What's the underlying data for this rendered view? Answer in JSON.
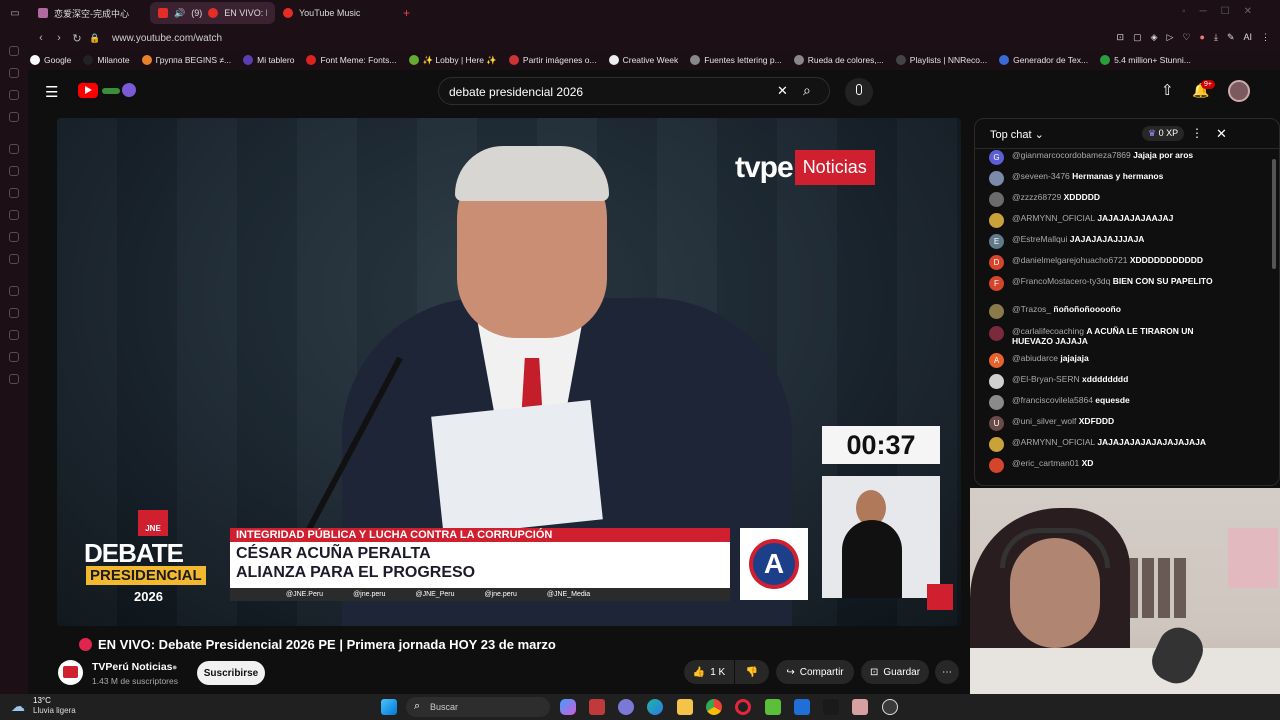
{
  "browser": {
    "tabs": [
      {
        "title": "恋爱深空-完成中心",
        "active": false
      },
      {
        "title": "(9)",
        "title2": "EN VIVO: Debat",
        "active": true
      },
      {
        "title": "YouTube Music",
        "active": false
      }
    ],
    "new_tab_glyph": "+",
    "url": "www.youtube.com/watch",
    "ai_label": "AI",
    "bookmarks": [
      {
        "label": "Google",
        "color": "#ffffff"
      },
      {
        "label": "Milanote",
        "color": "#222222"
      },
      {
        "label": "Группа BEGINS ≠...",
        "color": "#e8832b"
      },
      {
        "label": "Mi tablero",
        "color": "#5a3fb0"
      },
      {
        "label": "Font Meme: Fonts...",
        "color": "#d22"
      },
      {
        "label": "✨ Lobby | Here ✨",
        "color": "#6a3"
      },
      {
        "label": "Partir imágenes o...",
        "color": "#c33"
      },
      {
        "label": "Creative Week",
        "color": "#eee"
      },
      {
        "label": "Fuentes lettering p...",
        "color": "#888"
      },
      {
        "label": "Rueda de colores,...",
        "color": "#888"
      },
      {
        "label": "Playlists | NNReco...",
        "color": "#444"
      },
      {
        "label": "Generador de Tex...",
        "color": "#3b6ad6"
      },
      {
        "label": "5.4 million+ Stunni...",
        "color": "#2b9d3a"
      }
    ]
  },
  "youtube": {
    "search_query": "debate presidencial 2026",
    "notif_count": "9+",
    "video": {
      "channel_bug_tv": "tvpe",
      "channel_bug_noticias": "Noticias",
      "timer": "00:37",
      "lower_third_topic": "INTEGRIDAD PÚBLICA Y LUCHA CONTRA LA CORRUPCIÓN",
      "lower_third_name": "CÉSAR ACUÑA PERALTA",
      "lower_third_party": "ALIANZA PARA EL PROGRESO",
      "party_logo_letter": "A",
      "socials": [
        "@JNE.Peru",
        "@jne.peru",
        "@JNE_Peru",
        "@jne.peru",
        "@JNE_Media"
      ],
      "debate_logo_jne": "JNE",
      "debate_logo_title": "DEBATE",
      "debate_logo_sub": "PRESIDENCIAL",
      "debate_logo_year": "2026"
    },
    "title": "EN VIVO: Debate Presidencial 2026 PE | Primera jornada HOY 23 de marzo",
    "channel": {
      "name": "TVPerú Noticias",
      "subs": "1.43 M de suscriptores",
      "subscribe": "Suscribirse"
    },
    "actions": {
      "likes": "1 K",
      "share": "Compartir",
      "save": "Guardar"
    },
    "chat": {
      "header": "Top chat",
      "xp": "0 XP",
      "messages": [
        {
          "author": "@gianmarcocordobameza7869",
          "text": "Jajaja por aros",
          "avatar": "G",
          "color": "#5b5ed6"
        },
        {
          "author": "@seveen-3476",
          "text": "Hermanas y hermanos",
          "avatar": "",
          "color": "#7a8aa8"
        },
        {
          "author": "@zzzz68729",
          "text": "XDDDDD",
          "avatar": "",
          "color": "#6b6b6b"
        },
        {
          "author": "@ARMYNN_OFICIAL",
          "text": "JAJAJAJAJAAJAJ",
          "avatar": "",
          "color": "#c9a23a"
        },
        {
          "author": "@EstreMallqui",
          "text": "JAJAJAJAJJJAJA",
          "avatar": "E",
          "color": "#5f7a8a"
        },
        {
          "author": "@danielmelgarejohuacho6721",
          "text": "XDDDDDDDDDDD",
          "avatar": "D",
          "color": "#d4452b"
        },
        {
          "author": "@FrancoMostacero-ty3dq",
          "text": "BIEN CON SU PAPELITO",
          "avatar": "F",
          "color": "#d4452b"
        },
        {
          "author": "@Trazos_",
          "text": "ñoñoñoñooooño",
          "avatar": "",
          "color": "#8a7a4a"
        },
        {
          "author": "@carlalifecoaching",
          "text": "A ACUÑA LE TIRARON UN HUEVAZO JAJAJA",
          "avatar": "",
          "color": "#7a2a3a"
        },
        {
          "author": "@abiudarce",
          "text": "jajajaja",
          "avatar": "A",
          "color": "#e8632b"
        },
        {
          "author": "@El-Bryan-SERN",
          "text": "xdddddddd",
          "avatar": "",
          "color": "#cfcfcf"
        },
        {
          "author": "@franciscovilela5864",
          "text": "equesde",
          "avatar": "",
          "color": "#8a8a8a"
        },
        {
          "author": "@uni_silver_wolf",
          "text": "XDFDDD",
          "avatar": "U",
          "color": "#6b4a4a"
        },
        {
          "author": "@ARMYNN_OFICIAL",
          "text": "JAJAJAJAJAJAJAJAJAJA",
          "avatar": "",
          "color": "#c9a23a"
        },
        {
          "author": "@eric_cartman01",
          "text": "XD",
          "avatar": "",
          "color": "#d4452b"
        }
      ]
    }
  },
  "taskbar": {
    "temp": "13°C",
    "weather": "Lluvia ligera",
    "search": "Buscar"
  }
}
